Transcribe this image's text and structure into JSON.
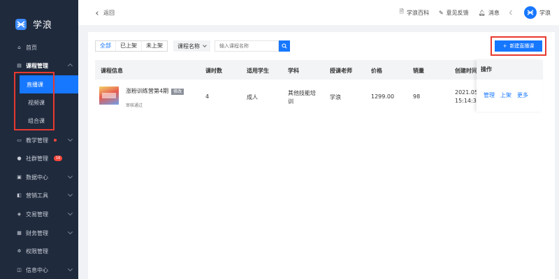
{
  "app": {
    "name": "学浪"
  },
  "sidebar": {
    "items": [
      {
        "label": "首页"
      },
      {
        "label": "课程管理"
      },
      {
        "label": "教学管理"
      },
      {
        "label": "社群管理",
        "badge": "16"
      },
      {
        "label": "数据中心"
      },
      {
        "label": "营销工具"
      },
      {
        "label": "交易管理"
      },
      {
        "label": "财务管理"
      },
      {
        "label": "权限管理"
      },
      {
        "label": "信息中心"
      }
    ],
    "sub_items": [
      {
        "label": "直播课"
      },
      {
        "label": "视频课"
      },
      {
        "label": "组合课"
      }
    ]
  },
  "topbar": {
    "back_label": "返回",
    "baike": "学浪百科",
    "feedback": "意见反馈",
    "messages": "消息",
    "user_name": "学浪"
  },
  "filters": {
    "tabs": [
      "全部",
      "已上架",
      "未上架"
    ],
    "active_tab": "全部",
    "field_select": "课程名称",
    "search_placeholder": "输入课程名称"
  },
  "actions": {
    "new_live_course": "新建直播课"
  },
  "table": {
    "columns": [
      "课程信息",
      "课时数",
      "适用学生",
      "学科",
      "授课老师",
      "价格",
      "销量",
      "创建时间",
      "操作"
    ],
    "rows": [
      {
        "title": "涨粉训练营第4期",
        "tag": "修改",
        "status": "审核通过",
        "lessons": "4",
        "students": "成人",
        "subject": "其他技能培训",
        "teacher": "学浪",
        "price": "1299.00",
        "sales": "98",
        "created_date": "2021.05",
        "created_time": "15:14:3",
        "ops": [
          "管理",
          "上架",
          "更多"
        ]
      }
    ]
  },
  "colors": {
    "primary": "#1677ff",
    "sidebar_bg": "#1f2a3d",
    "highlight": "#e8392f"
  }
}
